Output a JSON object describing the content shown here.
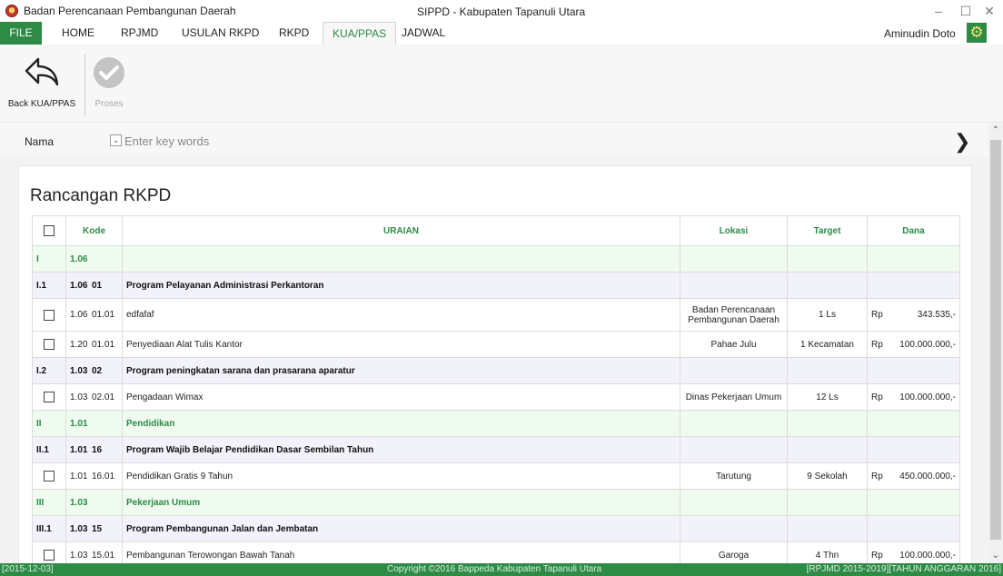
{
  "window": {
    "app_title": "Badan Perencanaan Pembangunan Daerah",
    "title": "SIPPD - Kabupaten Tapanuli Utara",
    "controls": {
      "minimize": "–",
      "maximize": "☐",
      "close": "✕"
    }
  },
  "ribbon": {
    "file_label": "FILE",
    "tabs": [
      {
        "label": "HOME"
      },
      {
        "label": "RPJMD"
      },
      {
        "label": "USULAN RKPD"
      },
      {
        "label": "RKPD"
      },
      {
        "label": "KUA/PPAS",
        "active": true
      },
      {
        "label": "JADWAL"
      }
    ],
    "user_name": "Aminudin Doto",
    "settings_icon": "gear-icon"
  },
  "toolbar": {
    "back_label": "Back KUA/PPAS",
    "back_icon": "back-arrow-icon",
    "proses_label": "Proses",
    "proses_icon": "check-circle-icon",
    "proses_enabled": false
  },
  "search": {
    "label": "Nama",
    "placeholder": "Enter key words",
    "value": "",
    "go_icon": "chevron-right-icon"
  },
  "main": {
    "title": "Rancangan RKPD",
    "columns": {
      "kode": "Kode",
      "uraian": "URAIAN",
      "lokasi": "Lokasi",
      "target": "Target",
      "dana": "Dana"
    },
    "rows": [
      {
        "level": "1",
        "no": "I",
        "kode_a": "1.06",
        "kode_b": "",
        "uraian": "",
        "lokasi": "",
        "target": "",
        "cur": "",
        "dana": ""
      },
      {
        "level": "2",
        "no": "I.1",
        "kode_a": "1.06",
        "kode_b": "01",
        "uraian": "Program Pelayanan Administrasi Perkantoran",
        "lokasi": "",
        "target": "",
        "cur": "",
        "dana": ""
      },
      {
        "level": "item",
        "no": "",
        "kode_a": "1.06",
        "kode_b": "01.01",
        "uraian": "edfafaf",
        "lokasi": "Badan Perencanaan Pembangunan Daerah",
        "target": "1 Ls",
        "cur": "Rp",
        "dana": "343.535,-"
      },
      {
        "level": "item",
        "no": "",
        "kode_a": "1.20",
        "kode_b": "01.01",
        "uraian": "Penyediaan Alat Tulis Kantor",
        "lokasi": "Pahae Julu",
        "target": "1 Kecamatan",
        "cur": "Rp",
        "dana": "100.000.000,-"
      },
      {
        "level": "2",
        "no": "I.2",
        "kode_a": "1.03",
        "kode_b": "02",
        "uraian": "Program peningkatan sarana dan prasarana aparatur",
        "lokasi": "",
        "target": "",
        "cur": "",
        "dana": ""
      },
      {
        "level": "item",
        "no": "",
        "kode_a": "1.03",
        "kode_b": "02.01",
        "uraian": "Pengadaan Wimax",
        "lokasi": "Dinas Pekerjaan Umum",
        "target": "12 Ls",
        "cur": "Rp",
        "dana": "100.000.000,-"
      },
      {
        "level": "1",
        "no": "II",
        "kode_a": "1.01",
        "kode_b": "",
        "uraian": "Pendidikan",
        "lokasi": "",
        "target": "",
        "cur": "",
        "dana": ""
      },
      {
        "level": "2",
        "no": "II.1",
        "kode_a": "1.01",
        "kode_b": "16",
        "uraian": "Program Wajib Belajar Pendidikan Dasar Sembilan Tahun",
        "lokasi": "",
        "target": "",
        "cur": "",
        "dana": ""
      },
      {
        "level": "item",
        "no": "",
        "kode_a": "1.01",
        "kode_b": "16.01",
        "uraian": "Pendidikan Gratis 9 Tahun",
        "lokasi": "Tarutung",
        "target": "9 Sekolah",
        "cur": "Rp",
        "dana": "450.000.000,-"
      },
      {
        "level": "1",
        "no": "III",
        "kode_a": "1.03",
        "kode_b": "",
        "uraian": "Pekerjaan Umum",
        "lokasi": "",
        "target": "",
        "cur": "",
        "dana": ""
      },
      {
        "level": "2",
        "no": "III.1",
        "kode_a": "1.03",
        "kode_b": "15",
        "uraian": "Program Pembangunan Jalan dan Jembatan",
        "lokasi": "",
        "target": "",
        "cur": "",
        "dana": ""
      },
      {
        "level": "item",
        "no": "",
        "kode_a": "1.03",
        "kode_b": "15.01",
        "uraian": "Pembangunan Terowongan Bawah Tanah",
        "lokasi": "Garoga",
        "target": "4 Thn",
        "cur": "Rp",
        "dana": "100.000.000,-"
      }
    ]
  },
  "statusbar": {
    "date": "[2015-12-03]",
    "copyright": "Copyright ©2016 Bappeda Kabupaten Tapanuli Utara",
    "period": "[RPJMD 2015-2019][TAHUN ANGGARAN 2016]"
  },
  "colors": {
    "accent": "#2d8b46",
    "level1_bg": "#eefbee",
    "level2_bg": "#f2f2fb"
  }
}
